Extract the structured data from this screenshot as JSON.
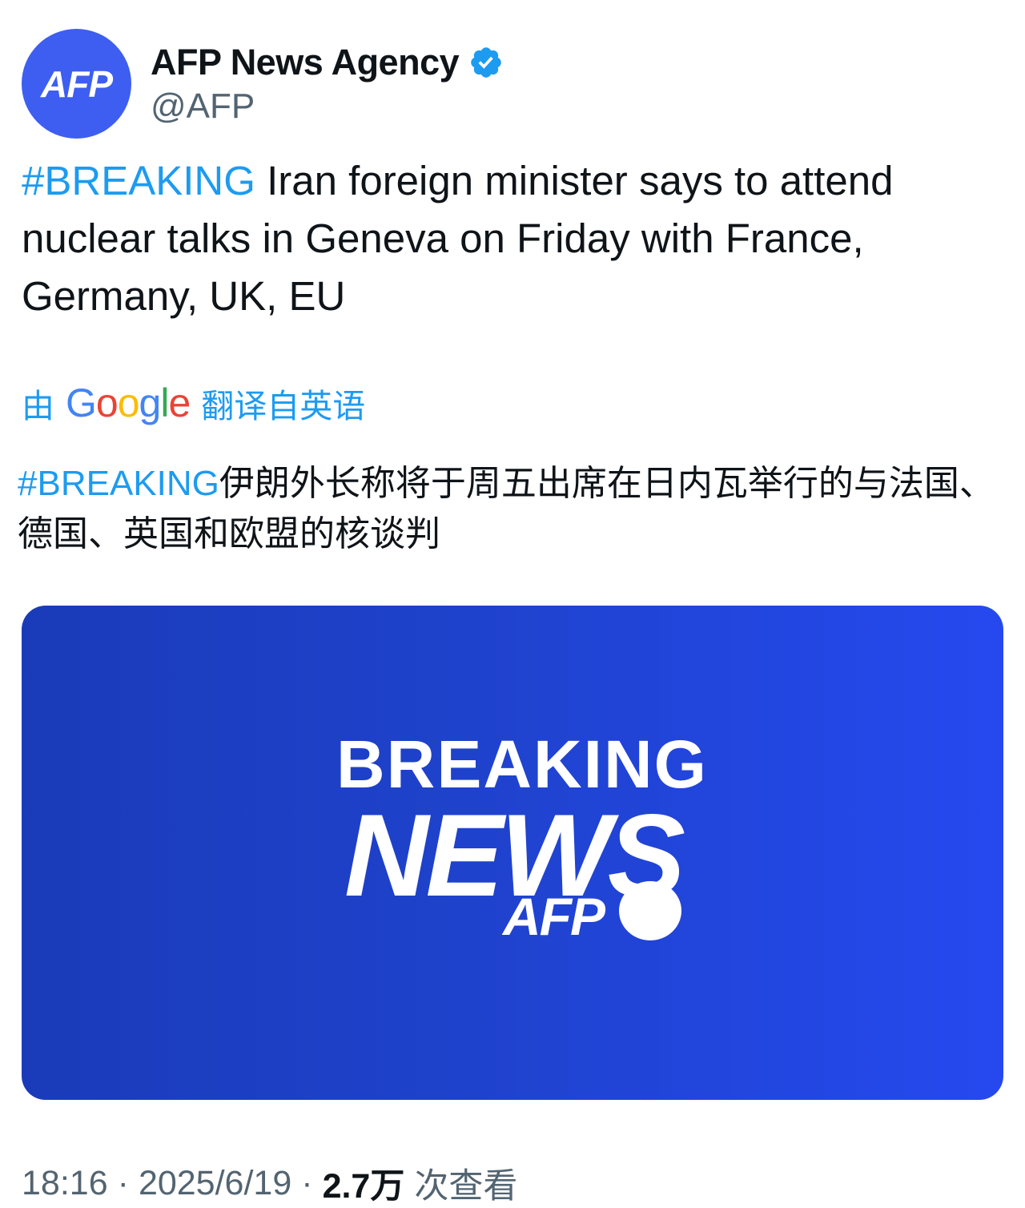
{
  "author": {
    "avatar_text": "AFP",
    "display_name": "AFP News Agency",
    "handle": "@AFP",
    "verified": true
  },
  "tweet": {
    "hashtag": "#BREAKING",
    "text": " Iran foreign minister says to attend nuclear talks in Geneva on Friday with France, Germany, UK, EU"
  },
  "translation": {
    "prefix": "由",
    "provider": "Google",
    "suffix": "翻译自英语",
    "hashtag": "#BREAKING",
    "text": "伊朗外长称将于周五出席在日内瓦举行的与法国、德国、英国和欧盟的核谈判"
  },
  "media": {
    "line1": "BREAKING",
    "line2": "NEWS",
    "brand": "AFP"
  },
  "meta": {
    "time": "18:16",
    "separator": "·",
    "date": "2025/6/19",
    "views_count": "2.7万",
    "views_label": "次查看"
  },
  "colors": {
    "link": "#1d9bf0",
    "avatar_bg": "#3d5ef0",
    "media_bg": "#2549ef",
    "muted_text": "#536471"
  },
  "icons": {
    "verified": "verified-badge-icon"
  }
}
